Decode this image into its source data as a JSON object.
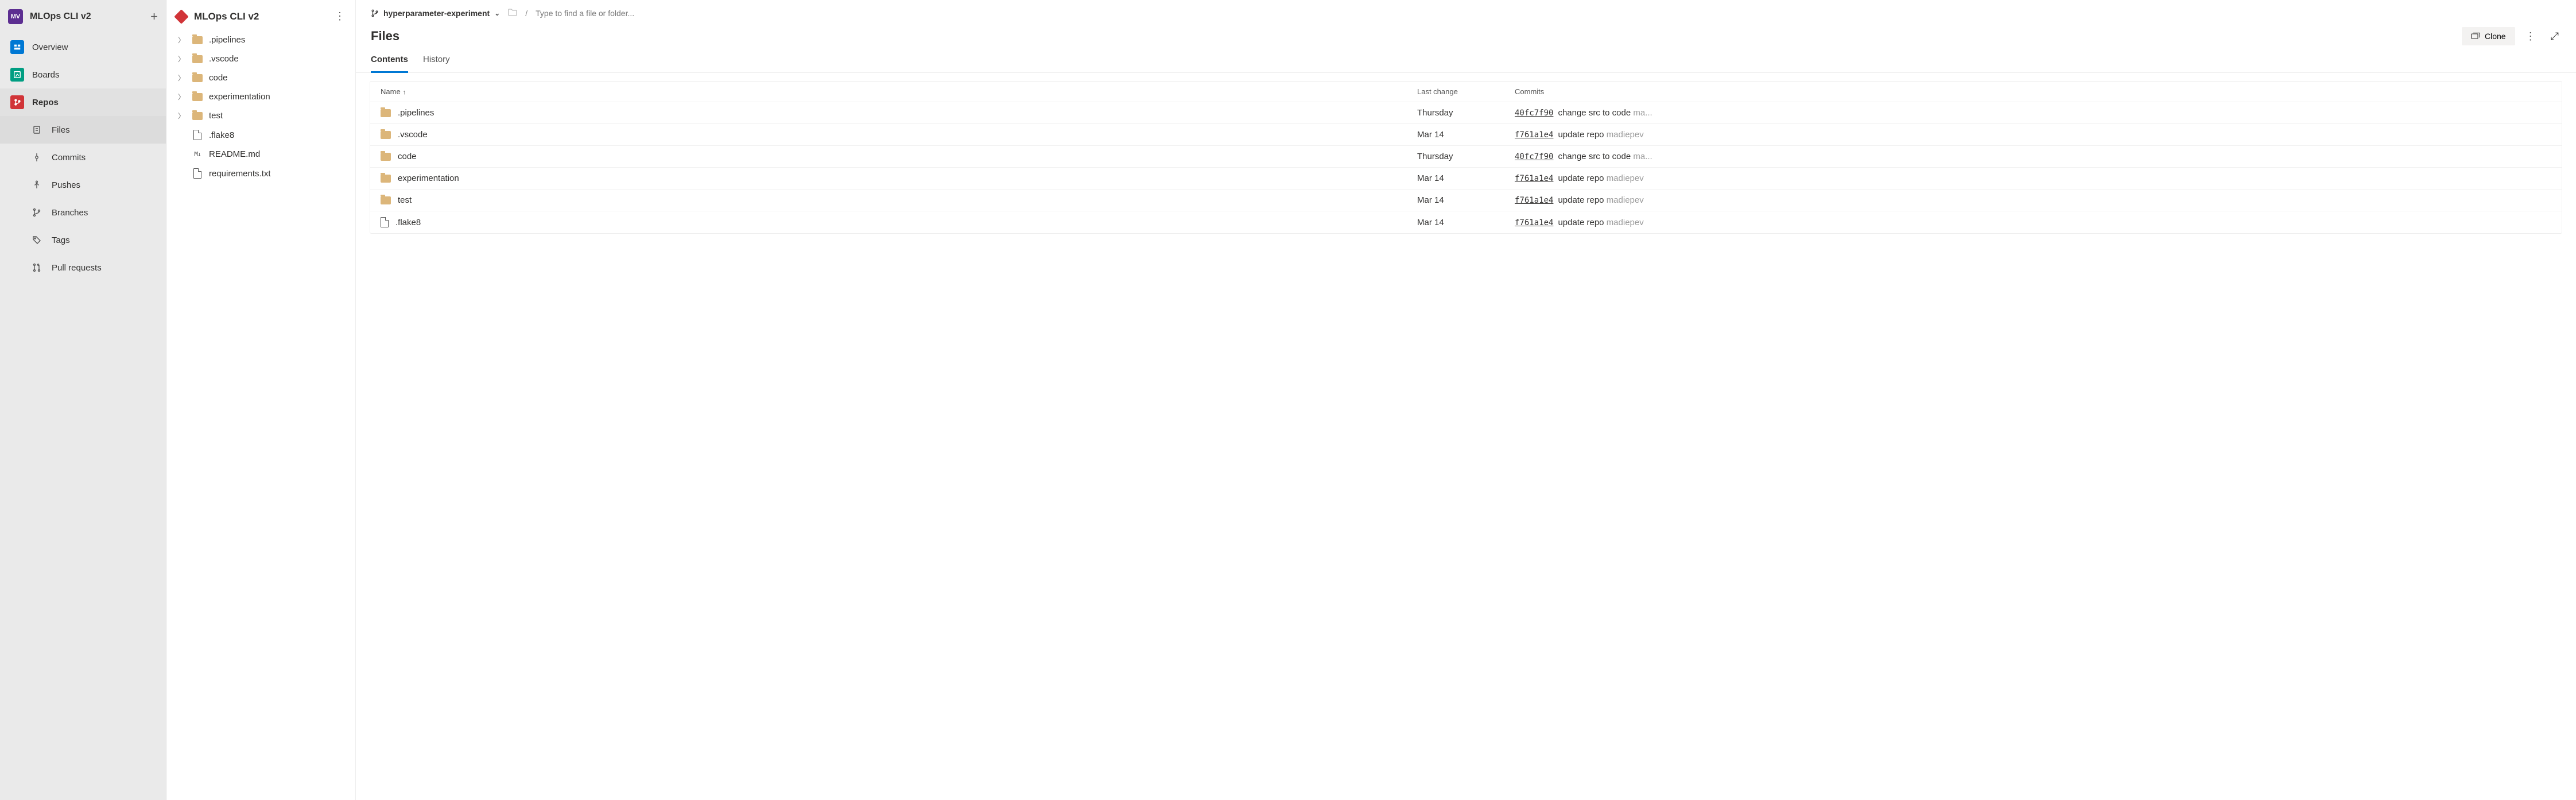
{
  "project": {
    "badge": "MV",
    "name": "MLOps CLI v2"
  },
  "leftNav": {
    "top": [
      {
        "id": "overview",
        "label": "Overview",
        "icon": "overview",
        "selected": false
      },
      {
        "id": "boards",
        "label": "Boards",
        "icon": "boards",
        "selected": false
      },
      {
        "id": "repos",
        "label": "Repos",
        "icon": "repos",
        "selected": true
      }
    ],
    "repoSub": [
      {
        "id": "files",
        "label": "Files",
        "icon": "files",
        "selected": true
      },
      {
        "id": "commits",
        "label": "Commits",
        "icon": "commits",
        "selected": false
      },
      {
        "id": "pushes",
        "label": "Pushes",
        "icon": "pushes",
        "selected": false
      },
      {
        "id": "branches",
        "label": "Branches",
        "icon": "branches",
        "selected": false
      },
      {
        "id": "tags",
        "label": "Tags",
        "icon": "tags",
        "selected": false
      },
      {
        "id": "pr",
        "label": "Pull requests",
        "icon": "pr",
        "selected": false
      }
    ]
  },
  "tree": {
    "title": "MLOps CLI v2",
    "items": [
      {
        "type": "folder",
        "name": ".pipelines",
        "expandable": true
      },
      {
        "type": "folder",
        "name": ".vscode",
        "expandable": true
      },
      {
        "type": "folder",
        "name": "code",
        "expandable": true
      },
      {
        "type": "folder",
        "name": "experimentation",
        "expandable": true
      },
      {
        "type": "folder",
        "name": "test",
        "expandable": true
      },
      {
        "type": "file",
        "name": ".flake8",
        "expandable": false
      },
      {
        "type": "md",
        "name": "README.md",
        "expandable": false
      },
      {
        "type": "file",
        "name": "requirements.txt",
        "expandable": false
      }
    ]
  },
  "main": {
    "branch": "hyperparameter-experiment",
    "pathPlaceholder": "Type to find a file or folder...",
    "title": "Files",
    "cloneLabel": "Clone",
    "tabs": [
      {
        "id": "contents",
        "label": "Contents",
        "active": true
      },
      {
        "id": "history",
        "label": "History",
        "active": false
      }
    ],
    "columns": {
      "name": "Name",
      "lastChange": "Last change",
      "commits": "Commits"
    },
    "rows": [
      {
        "type": "folder",
        "name": ".pipelines",
        "lastChange": "Thursday",
        "hash": "40fc7f90",
        "msg": "change src to code",
        "author": "ma...",
        "truncated": true
      },
      {
        "type": "folder",
        "name": ".vscode",
        "lastChange": "Mar 14",
        "hash": "f761a1e4",
        "msg": "update repo",
        "author": "madiepev",
        "truncated": false
      },
      {
        "type": "folder",
        "name": "code",
        "lastChange": "Thursday",
        "hash": "40fc7f90",
        "msg": "change src to code",
        "author": "ma...",
        "truncated": true
      },
      {
        "type": "folder",
        "name": "experimentation",
        "lastChange": "Mar 14",
        "hash": "f761a1e4",
        "msg": "update repo",
        "author": "madiepev",
        "truncated": false
      },
      {
        "type": "folder",
        "name": "test",
        "lastChange": "Mar 14",
        "hash": "f761a1e4",
        "msg": "update repo",
        "author": "madiepev",
        "truncated": false
      },
      {
        "type": "file",
        "name": ".flake8",
        "lastChange": "Mar 14",
        "hash": "f761a1e4",
        "msg": "update repo",
        "author": "madiepev",
        "truncated": false
      }
    ]
  }
}
